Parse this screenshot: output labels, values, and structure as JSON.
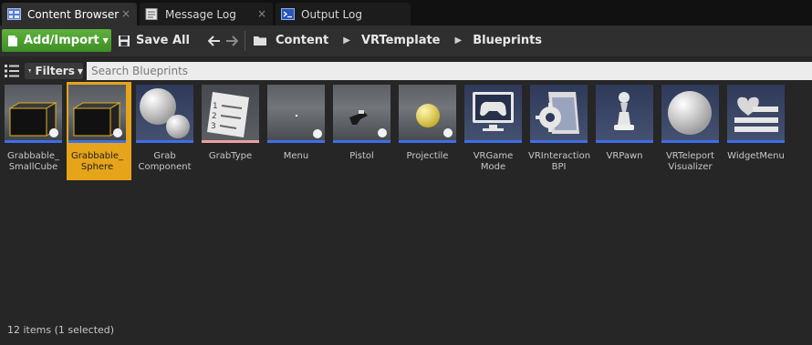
{
  "tabs": [
    {
      "label": "Content Browser",
      "icon": "content-browser-icon",
      "active": true
    },
    {
      "label": "Message Log",
      "icon": "message-log-icon",
      "active": false
    },
    {
      "label": "Output Log",
      "icon": "output-log-icon",
      "active": false
    }
  ],
  "tab_close_glyph": "×",
  "toolbar": {
    "add_import_label": "Add/Import",
    "save_all_label": "Save All",
    "breadcrumb": [
      "Content",
      "VRTemplate",
      "Blueprints"
    ],
    "back_icon": "arrow-left-icon",
    "forward_icon": "arrow-right-icon"
  },
  "filter_bar": {
    "filters_label": "Filters",
    "search_placeholder": "Search Blueprints"
  },
  "assets": [
    {
      "label": "Grabbable_\nSmallCube",
      "thumb": "cube",
      "selected": false
    },
    {
      "label": "Grabbable_\nSphere",
      "thumb": "cube",
      "selected": true
    },
    {
      "label": "Grab\nComponent",
      "thumb": "spheres",
      "selected": false
    },
    {
      "label": "GrabType",
      "thumb": "list-doc",
      "selected": false
    },
    {
      "label": "Menu",
      "thumb": "empty-floor",
      "selected": false
    },
    {
      "label": "Pistol",
      "thumb": "pistol",
      "selected": false
    },
    {
      "label": "Projectile",
      "thumb": "yellow-ball",
      "selected": false
    },
    {
      "label": "VRGame\nMode",
      "thumb": "gamepad",
      "selected": false
    },
    {
      "label": "VRInteraction\nBPI",
      "thumb": "interface",
      "selected": false
    },
    {
      "label": "VRPawn",
      "thumb": "pawn",
      "selected": false
    },
    {
      "label": "VRTeleport\nVisualizer",
      "thumb": "sphere",
      "selected": false
    },
    {
      "label": "WidgetMenu",
      "thumb": "widget",
      "selected": false
    }
  ],
  "colors": {
    "accent_green": "#4ea02f",
    "selection_orange": "#e5a41a",
    "asset_bar_blue": "#3e6fe8",
    "pink_bar": "#e8a0a0"
  },
  "status": {
    "text": "12 items (1 selected)"
  }
}
